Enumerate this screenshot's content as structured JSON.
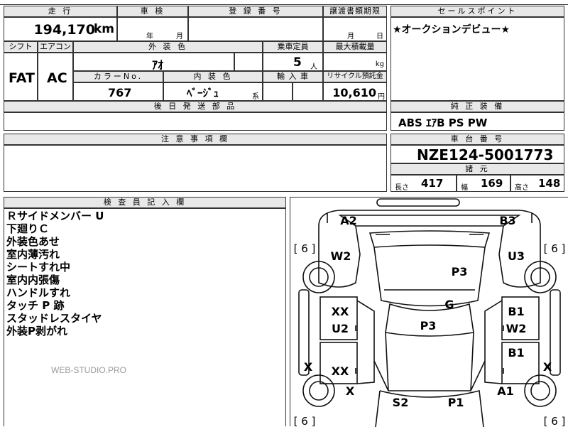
{
  "header": {
    "mileage_label": "走 行",
    "mileage_value": "194,170",
    "mileage_unit": "km",
    "inspection_label": "車 検",
    "inspection_year_unit": "年",
    "inspection_month_unit": "月",
    "registration_label": "登 録 番 号",
    "transfer_label": "譲渡書類期限",
    "transfer_month_unit": "月",
    "transfer_day_unit": "日"
  },
  "sales_point": {
    "label": "セールスポイント",
    "text": "★オークションデビュー★"
  },
  "spec": {
    "shift_label": "シフト",
    "shift_value": "FAT",
    "ac_label": "エアコン",
    "ac_value": "AC",
    "exterior_color_label": "外 装 色",
    "exterior_color_value": "ｱｵ",
    "capacity_label": "乗車定員",
    "capacity_value": "5",
    "capacity_unit": "人",
    "max_load_label": "最大積載量",
    "max_load_unit": "kg",
    "color_no_label": "カラーNo.",
    "color_no_value": "767",
    "interior_color_label": "内 装 色",
    "interior_color_value": "ﾍﾞｰｼﾞｭ",
    "interior_color_suffix": "系",
    "import_label": "輸 入 車",
    "recycle_label": "リサイクル預託金",
    "recycle_value": "10,610",
    "recycle_unit": "円",
    "later_parts_label": "後 日 発 送 部 品"
  },
  "equipment": {
    "label": "純 正 装 備",
    "value": "ABS ｴｱB PS PW"
  },
  "notes": {
    "label": "注 意 事 項 欄"
  },
  "chassis": {
    "label": "車 台 番 号",
    "value": "NZE124-5001773",
    "dims_label": "諸 元",
    "length_label": "長さ",
    "length_value": "417",
    "width_label": "幅",
    "width_value": "169",
    "height_label": "高さ",
    "height_value": "148"
  },
  "inspector": {
    "label": "検 査 員 記 入 欄",
    "lines": [
      "Ｒサイドメンバー U",
      "下廻りＣ",
      "外装色あせ",
      "室内薄汚れ",
      "シートすれ中",
      "室内内張傷",
      "ハンドルすれ",
      "タッチ P 跡",
      "スタッドレスタイヤ",
      "外装P剥がれ"
    ]
  },
  "watermark": "WEB-STUDIO.PRO",
  "diagram": {
    "labels": {
      "a2": "A2",
      "b3": "B3",
      "w2_top": "W2",
      "u3": "U3",
      "p3_top": "P3",
      "g": "G",
      "xx_left": "XX",
      "u2": "U2",
      "p3_mid": "P3",
      "b1_right": "B1",
      "w2_right": "W2",
      "b1_right2": "B1",
      "xx_left2": "XX",
      "x_left": "X",
      "x_right": "X",
      "x_bottom": "X",
      "a1": "A1",
      "s2": "S2",
      "p1": "P1"
    },
    "tire_depths": {
      "front_left": "[ 6 ]",
      "front_right": "[ 6 ]",
      "rear_left": "[ 6 ]",
      "rear_right": "[ 6 ]"
    }
  }
}
